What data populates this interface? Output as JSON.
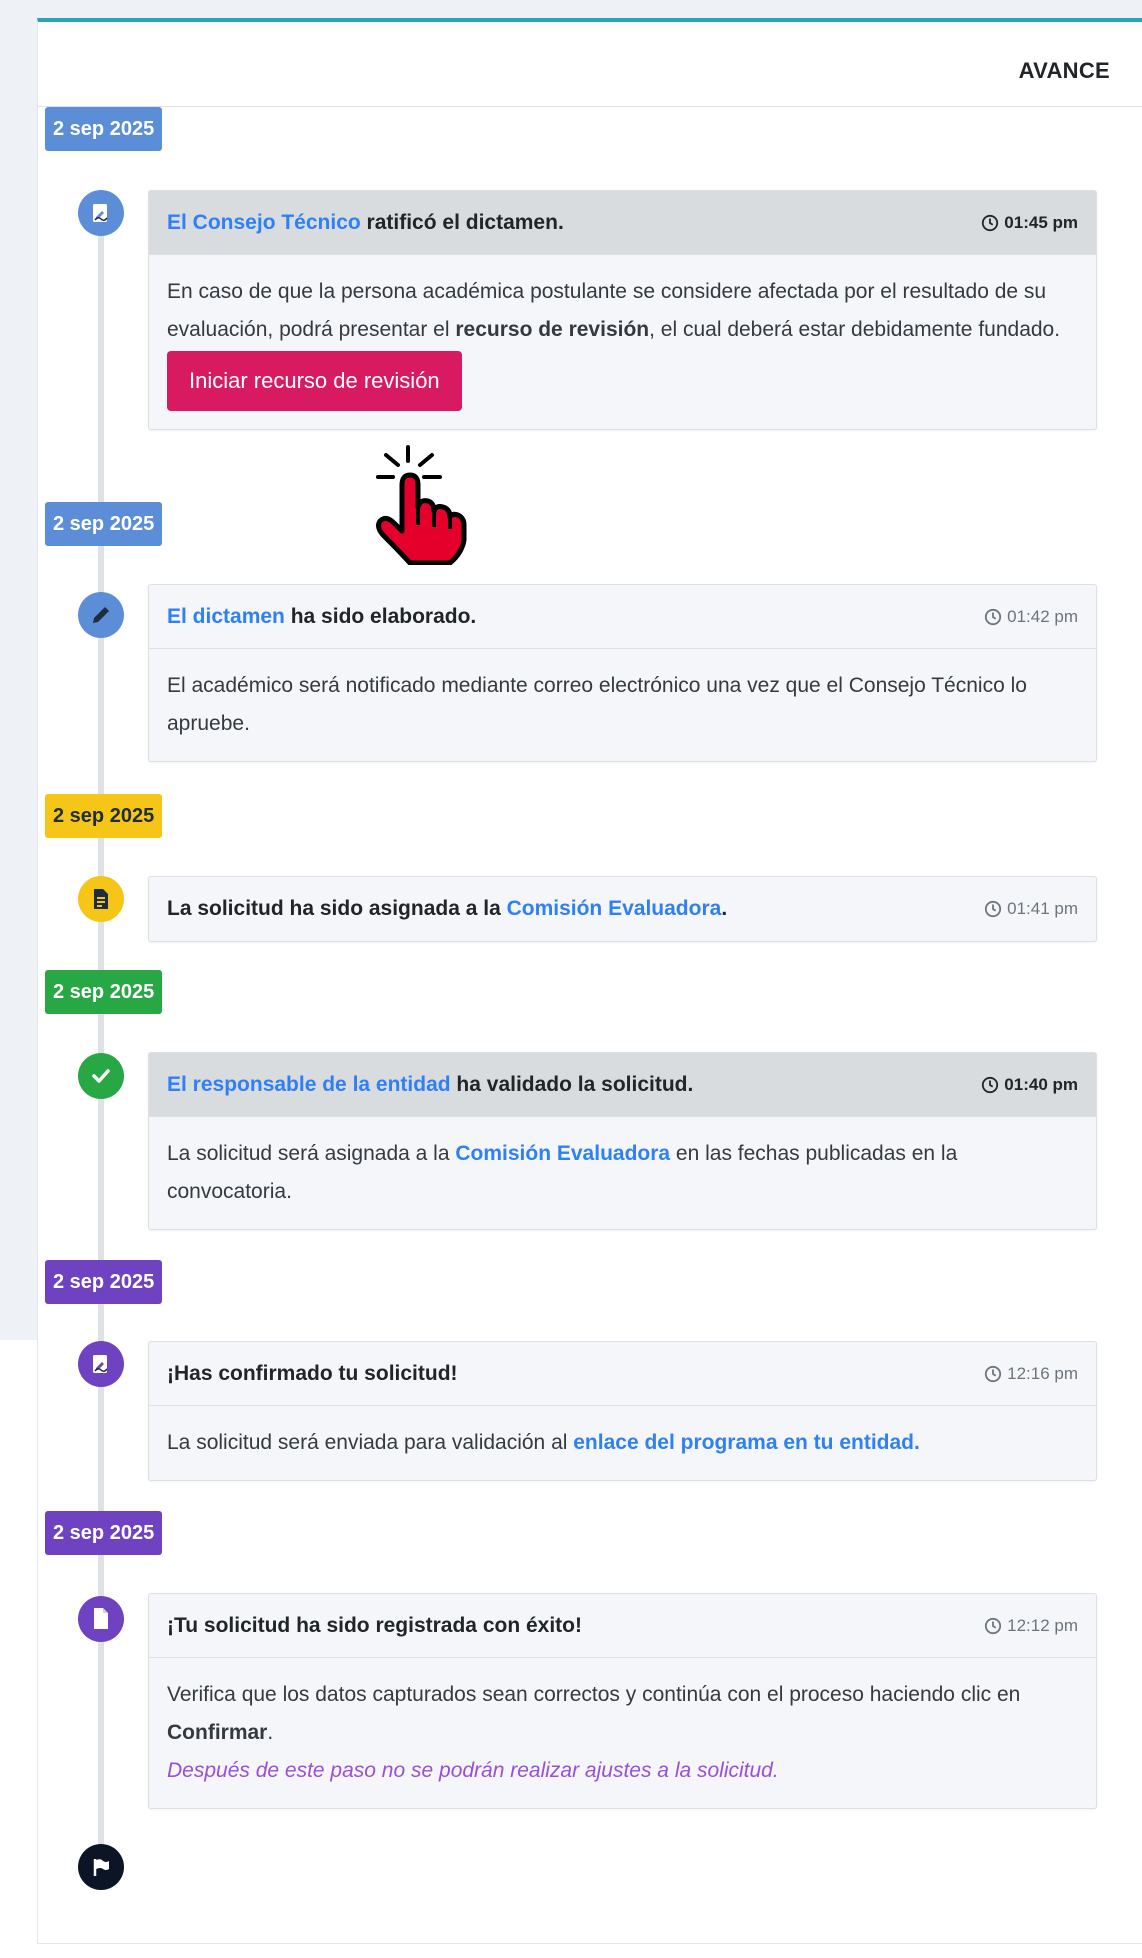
{
  "header": {
    "title": "AVANCE"
  },
  "events": [
    {
      "date": "2 sep 2025",
      "color": "#5c8ed8",
      "icon": "signature-icon",
      "title_link": "El Consejo Técnico",
      "title_rest": " ratificó el dictamen.",
      "time": "01:45 pm",
      "body_1": "En caso de que la persona académica postulante se considere afectada por el resultado de su evaluación, podrá presentar el ",
      "body_bold": "recurso de revisión",
      "body_2": ", el cual deberá estar debidamente fundado.",
      "button": "Iniciar recurso de revisión"
    },
    {
      "date": "2 sep 2025",
      "color": "#5c8ed8",
      "icon": "pencil-icon",
      "title_link": "El dictamen",
      "title_rest": " ha sido elaborado.",
      "time": "01:42 pm",
      "body": "El académico será notificado mediante correo electrónico una vez que el Consejo Técnico lo apruebe."
    },
    {
      "date": "2 sep 2025",
      "color": "#f5c518",
      "icon": "document-icon",
      "title_pre": "La solicitud ha sido asignada a la ",
      "title_link": "Comisión Evaluadora",
      "title_post": ".",
      "time": "01:41 pm"
    },
    {
      "date": "2 sep 2025",
      "color": "#28a745",
      "icon": "check-icon",
      "title_link": "El responsable de la entidad",
      "title_rest": " ha validado la solicitud.",
      "time": "01:40 pm",
      "body_1": "La solicitud será asignada a la ",
      "body_link": "Comisión Evaluadora",
      "body_2": " en las fechas publicadas en la convocatoria."
    },
    {
      "date": "2 sep 2025",
      "color": "#6f42c1",
      "icon": "signature-icon",
      "title": "¡Has confirmado tu solicitud!",
      "time": "12:16 pm",
      "body_1": "La solicitud será enviada para validación al ",
      "body_link": "enlace del programa en tu entidad."
    },
    {
      "date": "2 sep 2025",
      "color": "#6f42c1",
      "icon": "file-icon",
      "title": "¡Tu solicitud ha sido registrada con éxito!",
      "time": "12:12 pm",
      "body_1": "Verifica que los datos capturados sean correctos y continúa con el proceso haciendo clic en ",
      "body_bold": "Confirmar",
      "body_2": ".",
      "note": "Después de este paso no se podrán realizar ajustes a la solicitud."
    }
  ],
  "end_icon": "flag-icon"
}
